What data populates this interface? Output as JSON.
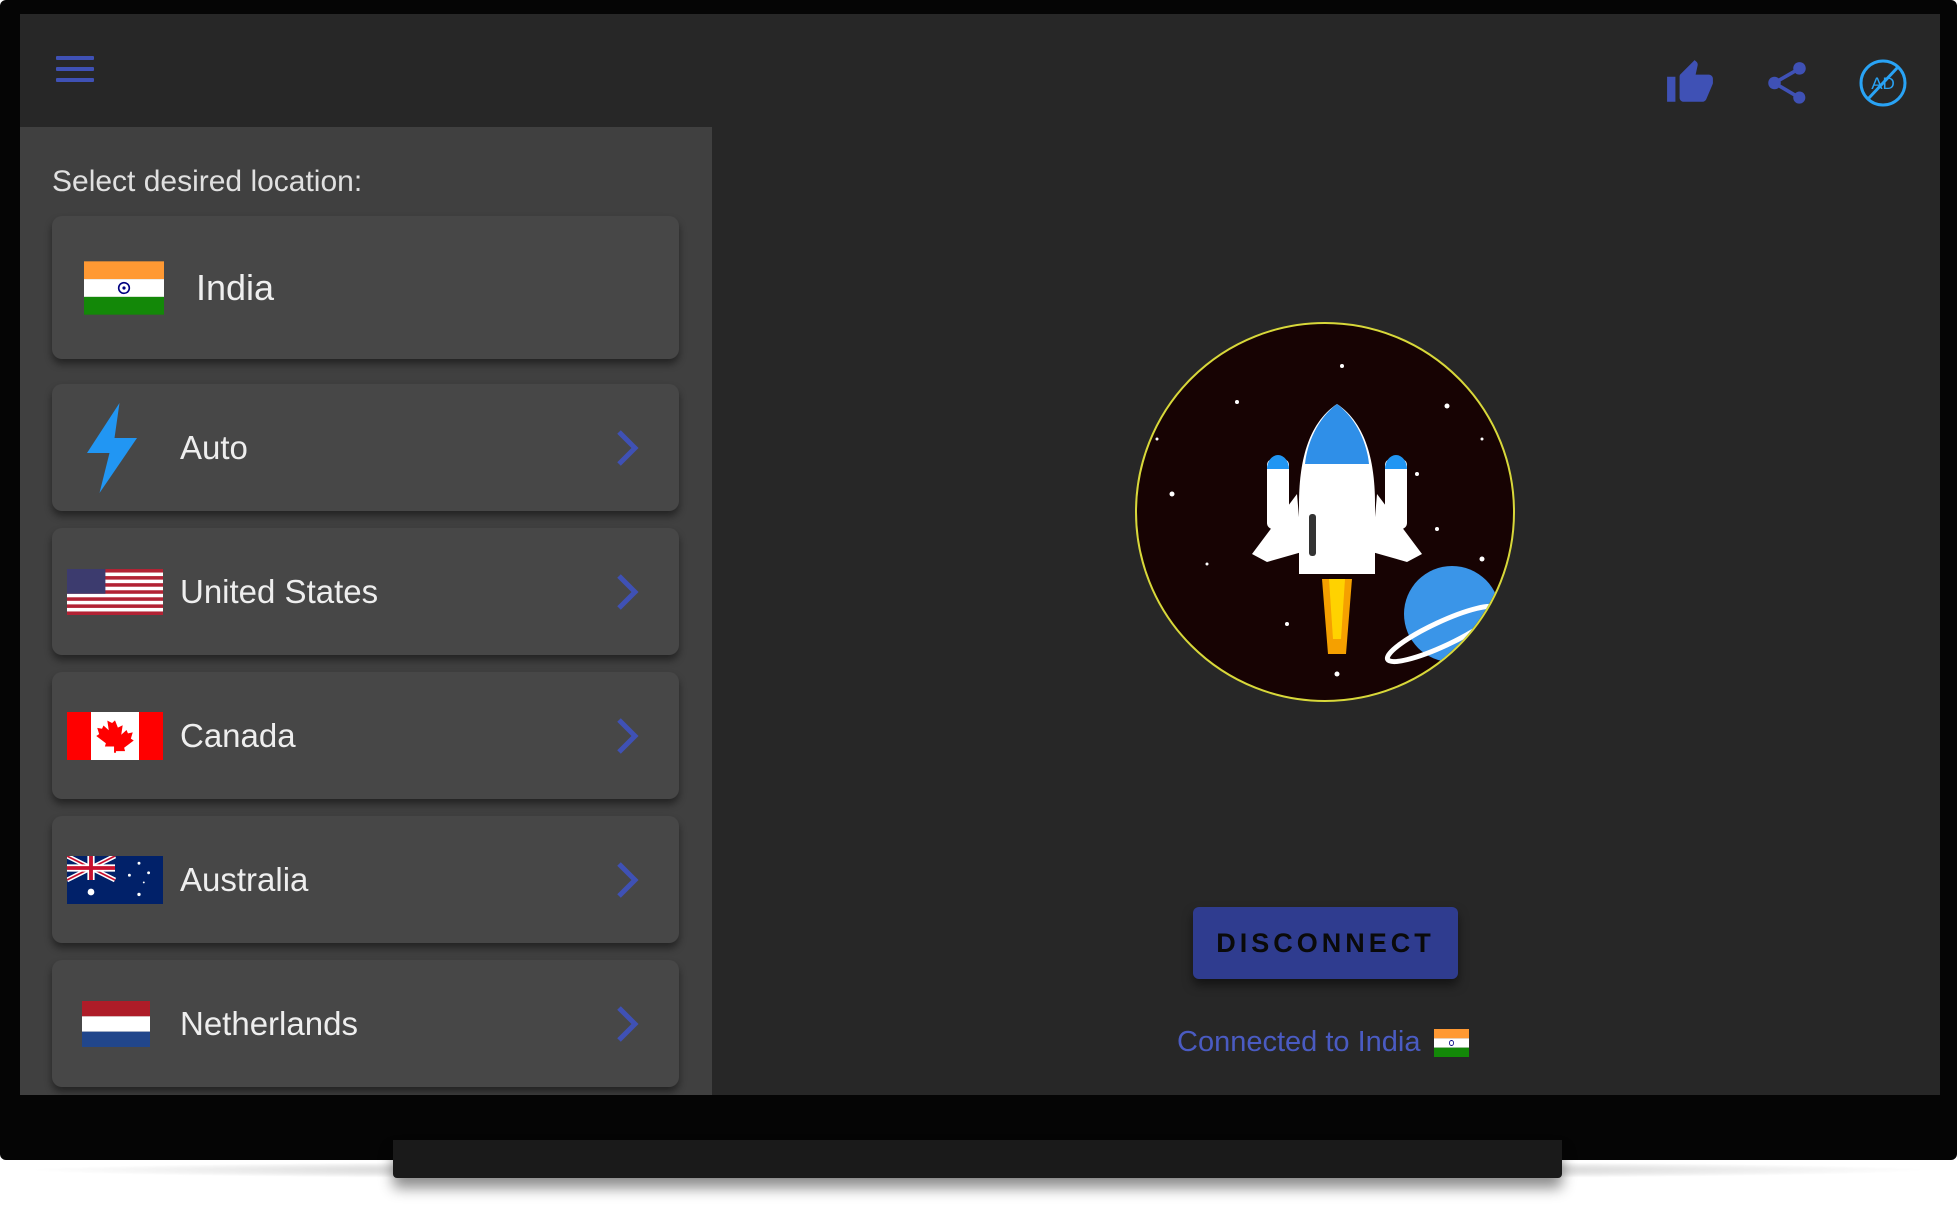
{
  "header": {
    "menu_icon": "hamburger-menu-icon",
    "actions": [
      {
        "icon": "thumbs-up-icon",
        "color": "#3f51b5"
      },
      {
        "icon": "share-icon",
        "color": "#3f51b5"
      },
      {
        "icon": "no-ads-icon",
        "label": "AD",
        "color": "#29a3f5"
      }
    ]
  },
  "locations": {
    "title": "Select desired location:",
    "selected": {
      "name": "India",
      "flag": "india-flag"
    },
    "items": [
      {
        "name": "Auto",
        "icon": "lightning-bolt-icon"
      },
      {
        "name": "United States",
        "icon": "us-flag"
      },
      {
        "name": "Canada",
        "icon": "canada-flag"
      },
      {
        "name": "Australia",
        "icon": "australia-flag"
      },
      {
        "name": "Netherlands",
        "icon": "netherlands-flag"
      }
    ]
  },
  "main": {
    "illustration": "rocket-launch-illustration",
    "button_label": "DISCONNECT",
    "status_text": "Connected to India",
    "status_flag": "india-flag"
  },
  "colors": {
    "accent": "#3f51b5",
    "button": "#2f3c8f",
    "status": "#4a5bc2",
    "ring": "#d8d83a"
  }
}
